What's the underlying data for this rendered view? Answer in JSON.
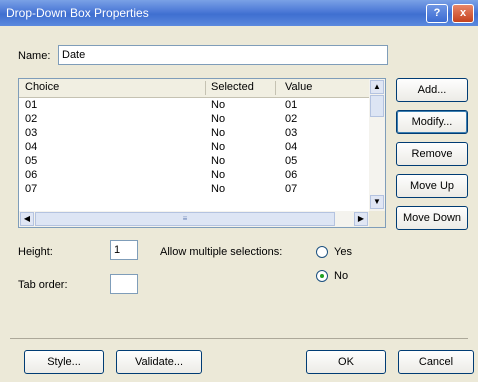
{
  "window": {
    "title": "Drop-Down Box Properties",
    "help_glyph": "?",
    "close_glyph": "x"
  },
  "name_field": {
    "label": "Name:",
    "value": "Date"
  },
  "choices": {
    "headers": [
      "Choice",
      "Selected",
      "Value"
    ],
    "rows": [
      {
        "choice": "01",
        "selected": "No",
        "value": "01"
      },
      {
        "choice": "02",
        "selected": "No",
        "value": "02"
      },
      {
        "choice": "03",
        "selected": "No",
        "value": "03"
      },
      {
        "choice": "04",
        "selected": "No",
        "value": "04"
      },
      {
        "choice": "05",
        "selected": "No",
        "value": "05"
      },
      {
        "choice": "06",
        "selected": "No",
        "value": "06"
      },
      {
        "choice": "07",
        "selected": "No",
        "value": "07"
      }
    ],
    "scroll_up_glyph": "▲",
    "scroll_down_glyph": "▼",
    "scroll_left_glyph": "◀",
    "scroll_right_glyph": "▶",
    "thumb_glyph": "≡"
  },
  "side_buttons": {
    "add": "Add...",
    "modify": "Modify...",
    "remove": "Remove",
    "move_up": "Move Up",
    "move_down": "Move Down"
  },
  "height": {
    "label": "Height:",
    "value": "1"
  },
  "tab_order": {
    "label": "Tab order:",
    "value": ""
  },
  "multiple": {
    "label": "Allow multiple selections:",
    "yes": "Yes",
    "no": "No",
    "selected": "No"
  },
  "footer_buttons": {
    "style": "Style...",
    "validate": "Validate...",
    "ok": "OK",
    "cancel": "Cancel"
  }
}
